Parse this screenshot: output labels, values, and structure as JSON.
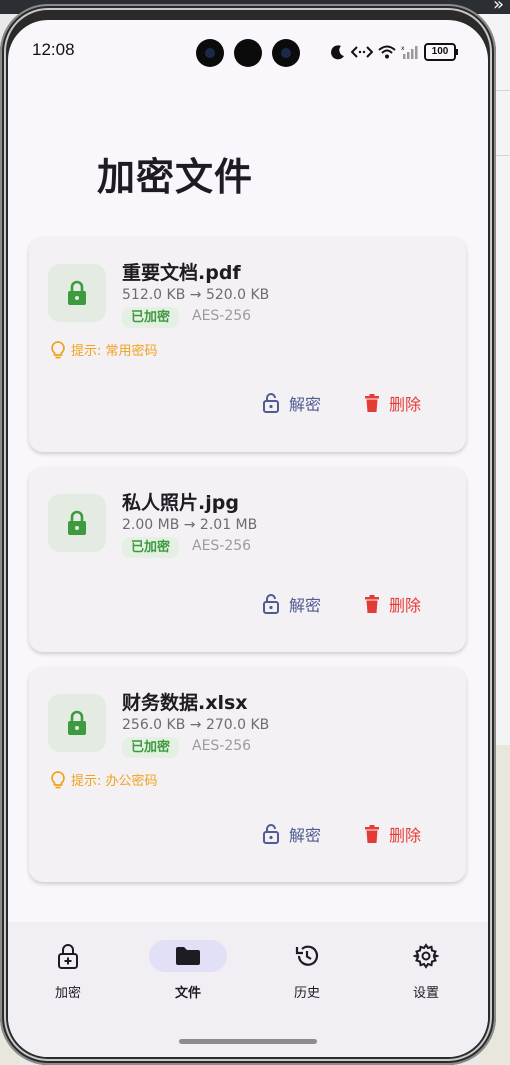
{
  "status": {
    "time": "12:08",
    "battery": "100"
  },
  "page": {
    "title": "加密文件"
  },
  "files": [
    {
      "name": "重要文档.pdf",
      "size": "512.0 KB → 520.0 KB",
      "badge": "已加密",
      "algorithm": "AES-256",
      "hint": "提示: 常用密码",
      "decrypt": "解密",
      "delete": "删除"
    },
    {
      "name": "私人照片.jpg",
      "size": "2.00 MB → 2.01 MB",
      "badge": "已加密",
      "algorithm": "AES-256",
      "hint": "",
      "decrypt": "解密",
      "delete": "删除"
    },
    {
      "name": "财务数据.xlsx",
      "size": "256.0 KB → 270.0 KB",
      "badge": "已加密",
      "algorithm": "AES-256",
      "hint": "提示: 办公密码",
      "decrypt": "解密",
      "delete": "删除"
    }
  ],
  "nav": [
    {
      "label": "加密",
      "icon": "lock-plus-icon"
    },
    {
      "label": "文件",
      "icon": "folder-icon",
      "active": true
    },
    {
      "label": "历史",
      "icon": "history-icon"
    },
    {
      "label": "设置",
      "icon": "gear-icon"
    }
  ],
  "colors": {
    "accent_green": "#3d9a3f",
    "decrypt_blue": "#4f5b92",
    "delete_red": "#e53b35",
    "hint_orange": "#f0a21d"
  }
}
